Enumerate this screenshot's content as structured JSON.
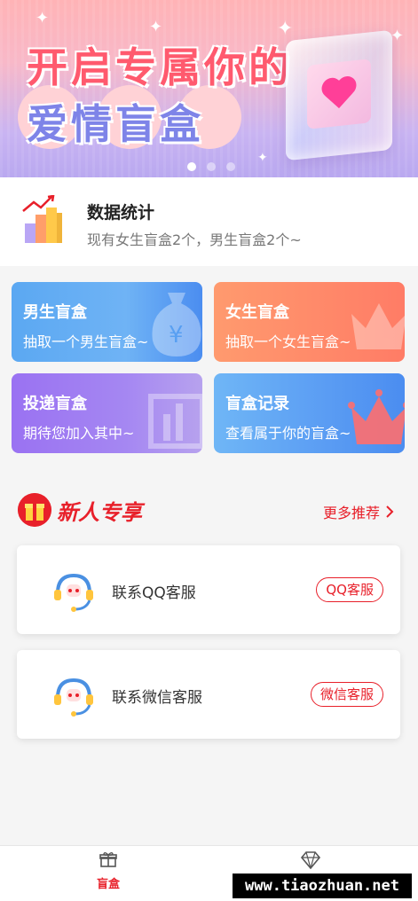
{
  "banner": {
    "line1": "开启专属你的",
    "line2": "爱情盲盒",
    "dots": [
      true,
      false,
      false
    ]
  },
  "stats": {
    "title": "数据统计",
    "subtitle": "现有女生盲盒2个，男生盲盒2个~"
  },
  "cards": {
    "boy": {
      "title": "男生盲盒",
      "subtitle": "抽取一个男生盲盒~"
    },
    "girl": {
      "title": "女生盲盒",
      "subtitle": "抽取一个女生盲盒~"
    },
    "deliver": {
      "title": "投递盲盒",
      "subtitle": "期待您加入其中~"
    },
    "record": {
      "title": "盲盒记录",
      "subtitle": "查看属于你的盲盒~"
    }
  },
  "section": {
    "title": "新人专享",
    "more": "更多推荐"
  },
  "services": {
    "qq": {
      "label": "联系QQ客服",
      "button": "QQ客服"
    },
    "wechat": {
      "label": "联系微信客服",
      "button": "微信客服"
    }
  },
  "tabbar": {
    "home": "盲盒",
    "mine": ""
  },
  "watermark": "www.tiaozhuan.net",
  "colors": {
    "accent": "#e8202a",
    "boy_card": "#5ba8f2",
    "girl_card": "#ff8a6a",
    "deliver_card": "#a07ef2",
    "record_card": "#5a9cf3"
  },
  "icons": {
    "stats": "bar-chart-icon",
    "section": "gift-icon",
    "service": "headset-icon",
    "tab_home": "gift-icon",
    "tab_mine": "diamond-icon",
    "more": "chevron-right-icon"
  }
}
